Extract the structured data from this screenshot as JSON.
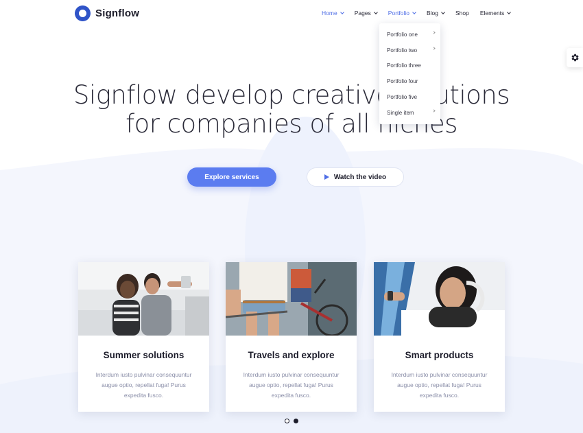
{
  "brand": {
    "name": "Signflow"
  },
  "nav": {
    "items": [
      {
        "label": "Home",
        "has_caret": true,
        "active": false,
        "highlight": true
      },
      {
        "label": "Pages",
        "has_caret": true
      },
      {
        "label": "Portfolio",
        "has_caret": true,
        "active": true
      },
      {
        "label": "Blog",
        "has_caret": true
      },
      {
        "label": "Shop",
        "has_caret": false
      },
      {
        "label": "Elements",
        "has_caret": true
      }
    ]
  },
  "dropdown": {
    "items": [
      {
        "label": "Portfolio one",
        "has_submenu": true
      },
      {
        "label": "Portfolio two",
        "has_submenu": true
      },
      {
        "label": "Portfolio three",
        "has_submenu": false
      },
      {
        "label": "Portfolio four",
        "has_submenu": false
      },
      {
        "label": "Portfolio five",
        "has_submenu": false
      },
      {
        "label": "Single item",
        "has_submenu": true
      }
    ]
  },
  "hero": {
    "line1": "Signflow develop creative solutions",
    "line2": "for companies of all niches",
    "primary_button": "Explore services",
    "video_button": "Watch the video"
  },
  "cards": [
    {
      "title": "Summer solutions",
      "text": "Interdum iusto pulvinar consequuntur augue optio, repellat fuga! Purus expedita fusco."
    },
    {
      "title": "Travels and explore",
      "text": "Interdum iusto pulvinar consequuntur augue optio, repellat fuga! Purus expedita fusco."
    },
    {
      "title": "Smart products",
      "text": "Interdum iusto pulvinar consequuntur augue optio, repellat fuga! Purus expedita fusco."
    }
  ],
  "pagination": {
    "active_index": 1,
    "count": 2
  },
  "colors": {
    "accent": "#5b7cf0",
    "nav_active": "#4f6ee6",
    "brand": "#2f54c8",
    "text_dark": "#1d1d2b",
    "text_muted": "#8a8ea8",
    "bg_wave": "#f2f5fd"
  },
  "icons": {
    "settings": "gear-icon",
    "play": "play-icon"
  }
}
